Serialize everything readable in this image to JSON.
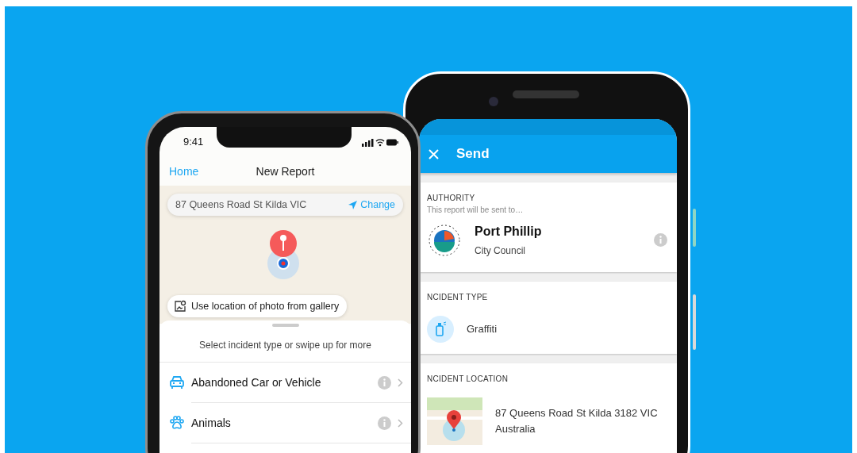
{
  "ios_screen": {
    "status_time": "9:41",
    "nav": {
      "back": "Home",
      "title": "New Report"
    },
    "address_bar": {
      "address": "87 Queens Road St Kilda VIC",
      "action": "Change"
    },
    "photo_location_button": "Use location of photo from gallery",
    "sheet": {
      "prompt": "Select incident type or swipe up for more",
      "incident_types": [
        {
          "label": "Abandoned Car or Vehicle",
          "kind": "car"
        },
        {
          "label": "Animals",
          "kind": "paw"
        }
      ]
    }
  },
  "android_screen": {
    "app_bar": {
      "title": "Send"
    },
    "sections": [
      {
        "kind": "authority",
        "heading": "AUTHORITY",
        "subheading": "This report will be sent to…",
        "name": "Port Phillip",
        "detail": "City Council"
      },
      {
        "kind": "type",
        "heading": "NCIDENT TYPE",
        "value": "Graffiti"
      },
      {
        "kind": "location",
        "heading": "NCIDENT LOCATION",
        "lines": [
          "87 Queens Road St Kilda 3182 VIC",
          "Australia"
        ]
      }
    ]
  }
}
